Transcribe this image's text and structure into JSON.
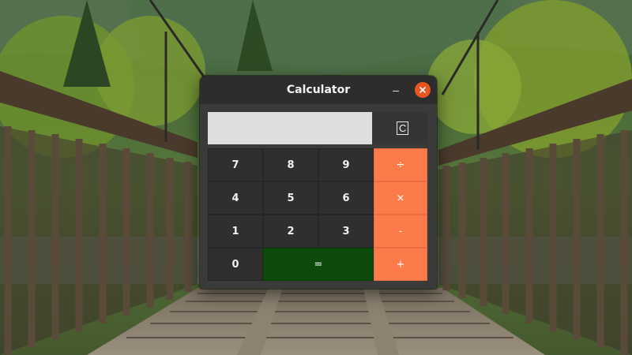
{
  "window": {
    "title": "Calculator",
    "minimize_glyph": "–"
  },
  "calculator": {
    "display_value": "",
    "clear_label": "C",
    "keys": {
      "k7": "7",
      "k8": "8",
      "k9": "9",
      "div": "÷",
      "k4": "4",
      "k5": "5",
      "k6": "6",
      "mul": "×",
      "k1": "1",
      "k2": "2",
      "k3": "3",
      "sub": "-",
      "k0": "0",
      "eq": "=",
      "add": "+"
    }
  },
  "colors": {
    "operator_key": "#fd7a4a",
    "equals_key": "#0b4a0b",
    "number_key": "#2f2f2f",
    "close_button": "#e95420"
  }
}
